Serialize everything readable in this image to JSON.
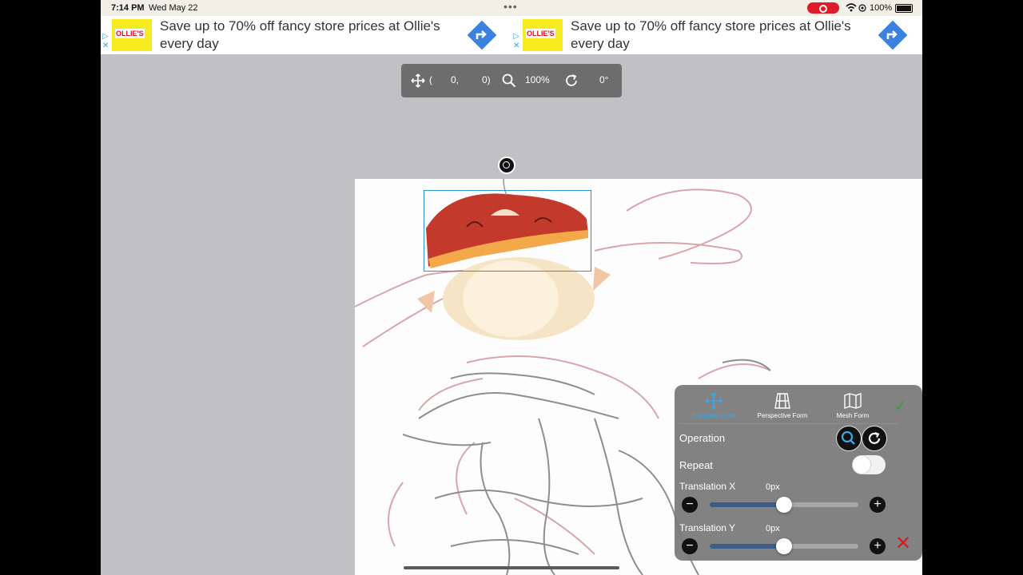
{
  "status_bar": {
    "time": "7:14 PM",
    "date": "Wed May 22",
    "battery": "100%"
  },
  "ads": [
    {
      "logo": "OLLIE'S",
      "text": "Save up to 70% off fancy store prices at Ollie's every day"
    },
    {
      "logo": "OLLIE'S",
      "text": "Save up to 70% off fancy store prices at Ollie's every day"
    }
  ],
  "toolbar": {
    "pos_open": "(",
    "x": "0,",
    "y": "0)",
    "zoom": "100%",
    "rotation": "0°"
  },
  "panel": {
    "tabs": [
      {
        "label": "Translate Scale",
        "icon": "move-arrows-icon",
        "active": true
      },
      {
        "label": "Perspective Form",
        "icon": "perspective-grid-icon"
      },
      {
        "label": "Mesh Form",
        "icon": "mesh-map-icon"
      }
    ],
    "operation_label": "Operation",
    "repeat_label": "Repeat",
    "translation_x": {
      "label": "Translation X",
      "value": "0px",
      "slider_fraction": 0.5
    },
    "translation_y": {
      "label": "Translation Y",
      "value": "0px",
      "slider_fraction": 0.5
    }
  },
  "colors": {
    "accent": "#3da5e0",
    "confirm": "#3a9d3a",
    "cancel": "#d01f1f",
    "selection": "#2c94c7"
  }
}
